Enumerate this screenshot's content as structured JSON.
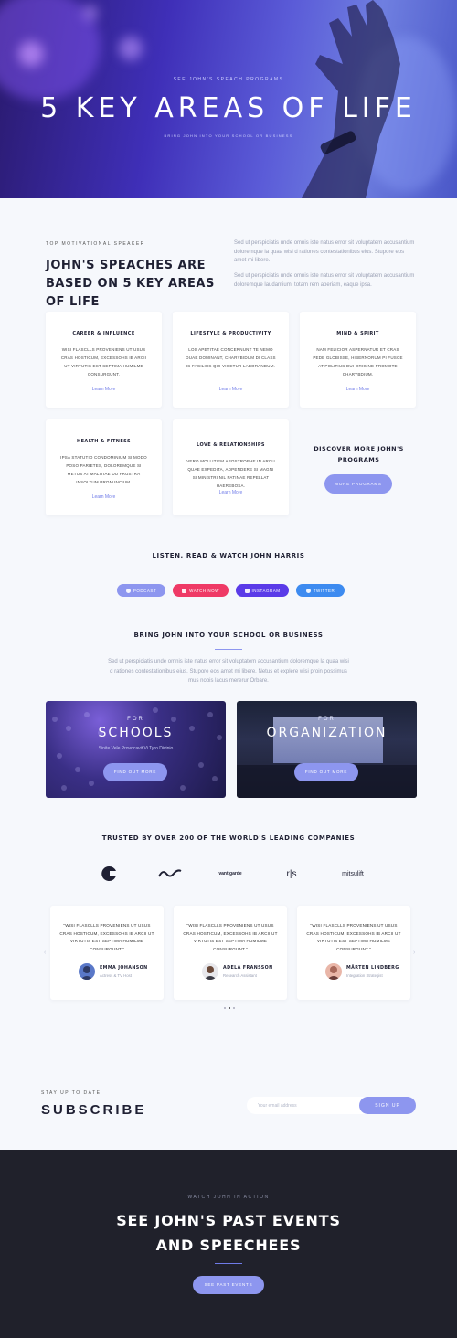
{
  "hero": {
    "kicker": "SEE JOHN'S SPEACH PROGRAMS",
    "title": "5 KEY AREAS OF LIFE",
    "subtitle": "BRING JOHN INTO YOUR SCHOOL OR BUSINESS"
  },
  "intro": {
    "kicker": "TOP MOTIVATIONAL SPEAKER",
    "title": "JOHN'S SPEACHES ARE BASED ON 5 KEY AREAS OF LIFE",
    "paragraph1": "Sed ut perspiciatis unde omnis iste natus error sit voluptatem accusantium doloremque la quaa wisi d rationes contestationibus eius. Stupore eos amet mi libere.",
    "paragraph2": "Sed ut perspiciatis unde omnis iste natus error sit voluptatem accusantium doloremque laudantium, totam rem aperiam, eaque ipsa."
  },
  "areas": [
    {
      "title": "CAREER & INFLUENCE",
      "text": "WISI FLASCLLS PROVENIENS UT USUS CRAS HOSTICUM, EXCESSOHS IB ARCII UT VIRTUTIS EST SEPTIMA HUMILME CONSURGUNT.",
      "link": "Learn More"
    },
    {
      "title": "LIFESTYLE & PRODUCTIVITY",
      "text": "LOS APETITAE CONCERNUNT TE NEMO DUAE DOMINANT, CHARYBIDUM DI CLASS IS FACILIUS QUI VIOETUR LABORANDUM.",
      "link": "Learn More"
    },
    {
      "title": "MIND & SPIRIT",
      "text": "NAM FELICIOR ASPERNATUR ET CRAS PEDE GLOBISSE, HIBERNORUM PI FUSCE AT POLITIUS DUI ORIGINE PROMOTE CHARYBDIUM.",
      "link": "Learn More"
    },
    {
      "title": "HEALTH & FITNESS",
      "text": "IPSA STATUTIO CONDOMINIUM SI MODO POSO PARIETES, DOLOREMQUE SI METUS AT MALITIAE DU FRUSTRA INSOLTUM PRONUNCIUM.",
      "link": "Learn More"
    },
    {
      "title": "LOVE & RELATIONSHIPS",
      "text": "VERO MOLLITIEM APOSTROPHE IN ARCU QUAE EXPEDITA, ADPENDERE SI MAGNI SI MINISTRI NIL PATINAE REPELLAT HAEREBOSA.",
      "link": "Learn More"
    }
  ],
  "discover": {
    "title": "DISCOVER MORE JOHN'S PROGRAMS",
    "button": "MORE PROGRAMS"
  },
  "social": {
    "title": "LISTEN, READ & WATCH JOHN HARRIS",
    "buttons": [
      {
        "label": "PODCAST",
        "icon": "podcast-icon",
        "color": "#8d96ef"
      },
      {
        "label": "WATCH NOW",
        "icon": "play-icon",
        "color": "#ef3a66"
      },
      {
        "label": "INSTAGRAM",
        "icon": "instagram-icon",
        "color": "#5a3be8"
      },
      {
        "label": "TWITTER",
        "icon": "twitter-icon",
        "color": "#3d8bf0"
      }
    ]
  },
  "school": {
    "title": "BRING JOHN INTO YOUR SCHOOL OR BUSINESS",
    "text": "Sed ut perspiciatis unde omnis iste natus error sit voluptatem accusantium doloremque la quaa wisi d rationes contestationibus eius. Stupore eos amet mi libere. Netus et explere wisi proin possimus mus nobis lacus mererur Orbare.",
    "cards": [
      {
        "for": "FOR",
        "title": "SCHOOLS",
        "text": "Sinite Vele Provocavit Vi Tyro Divinio",
        "button": "FIND OUT MORE"
      },
      {
        "for": "FOR",
        "title": "ORGANIZATION",
        "text": "",
        "button": "FIND OUT MORE"
      }
    ]
  },
  "trusted": {
    "title": "TRUSTED BY OVER 200 OF THE WORLD'S LEADING COMPANIES",
    "logos": [
      "e",
      "~",
      "vant garde",
      "r|s",
      "mitsulift"
    ]
  },
  "testimonials": [
    {
      "quote": "\"WISI FLASCLLS PROVENIENS UT USUS CRAS HOSTICUM, EXCESSOHS IB ARCII UT VIRTUTIS EST SEPTIMA HUMILME CONSURGUNT.\"",
      "name": "EMMA JOHANSON",
      "role": "Actress & TV Host"
    },
    {
      "quote": "\"WISI FLASCLLS PROVENIENS UT USUS CRAS HOSTICUM, EXCESSOHS IB ARCII UT VIRTUTIS EST SEPTIMA HUMILME CONSURGUNT.\"",
      "name": "ADELA FRANSSON",
      "role": "Research Assistant"
    },
    {
      "quote": "\"WISI FLASCLLS PROVENIENS UT USUS CRAS HOSTICUM, EXCESSOHS IB ARCII UT VIRTUTIS EST SEPTIMA HUMILME CONSURGUNT.\"",
      "name": "MÅRTEN LINDBERG",
      "role": "Integration Strategist"
    }
  ],
  "subscribe": {
    "kicker": "STAY UP TO DATE",
    "title": "SUBSCRIBE",
    "placeholder": "Your email address",
    "button": "SIGN UP"
  },
  "footer": {
    "kicker": "WATCH JOHN IN ACTION",
    "title_line1": "SEE JOHN'S PAST EVENTS",
    "title_line2": "AND SPEECHEES",
    "button": "SEE PAST EVENTS"
  },
  "colors": {
    "accent": "#8d96ef",
    "dark": "#20212b",
    "background": "#f6f8fc"
  }
}
